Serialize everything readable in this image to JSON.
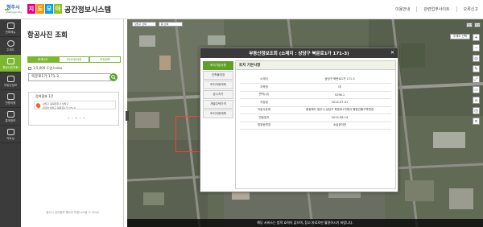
{
  "header": {
    "logo_city": "청주시",
    "logo_sub": "cheongju city",
    "title_tiles": [
      {
        "char": "지",
        "color": "#e4007f"
      },
      {
        "char": "도",
        "color": "#f39800"
      },
      {
        "char": "모",
        "color": "#009fe8"
      },
      {
        "char": "아",
        "color": "#8fc31f"
      }
    ],
    "title_rest": "공간정보시스템",
    "links": [
      "이용안내",
      "관련업무사이트",
      "오류신고"
    ]
  },
  "leftnav": {
    "items": [
      {
        "label": "전체메뉴"
      },
      {
        "label": "주제도"
      },
      {
        "label": "항공사진조회",
        "active": true
      },
      {
        "label": "부동산정보"
      },
      {
        "label": "민원지원"
      },
      {
        "label": "통계정보"
      },
      {
        "label": "자료실"
      }
    ]
  },
  "panel": {
    "title": "항공사진 조회",
    "year_tabs": [
      "현재년도",
      "2019년사진",
      "이전년도"
    ],
    "resolution_label": "1:5,000 도엽 Index",
    "search_value": "북문로1가 171-3",
    "result_count": "검색결과 1건",
    "result_addr1": "상당구 충북청주시 상당구",
    "result_addr2": "[지번] 상당구 북문로1가 171-3",
    "pager": [
      "«",
      "‹",
      "1",
      "›",
      "»"
    ],
    "copyright": "청주시 공간정보 웹GIS 민원시스템 © 2016"
  },
  "map": {
    "selects": [
      "상당구 선택",
      "동 선택"
    ],
    "view_buttons": [
      "일반",
      "위성"
    ],
    "mode_label": "주제도 선택",
    "tools": [
      "+",
      "−",
      "◎",
      "✎",
      "⤢",
      "▭",
      "⌂",
      "◷",
      "✕"
    ],
    "notice": "해당 서비스는 법적 효력이 없으며, 참고 자료로만 활용하시기 바랍니다."
  },
  "dialog": {
    "title": "부동산정보조회 (소재지 : 상당구 북문로1가 171-3)",
    "close": "✕",
    "tabs": [
      "토지기본사항",
      "건축물대장",
      "토지이용계획",
      "공시지가",
      "개별주택가격",
      "토지이용계획"
    ],
    "section_title": "토지 기본사항",
    "rows": [
      {
        "label": "소재지",
        "value": "상당구 북문로1가 171-3"
      },
      {
        "label": "지목명",
        "value": "대"
      },
      {
        "label": "면적(㎡)",
        "value": "5298.1"
      },
      {
        "label": "지정일",
        "value": "2014-07-01"
      },
      {
        "label": "이동사유명",
        "value": "충청북도 청주시 상당구 북문로1가에서 행정관할구역변경"
      },
      {
        "label": "변동일자",
        "value": "2014-08-14"
      },
      {
        "label": "법정동변경",
        "value": "소유권이전"
      }
    ]
  }
}
